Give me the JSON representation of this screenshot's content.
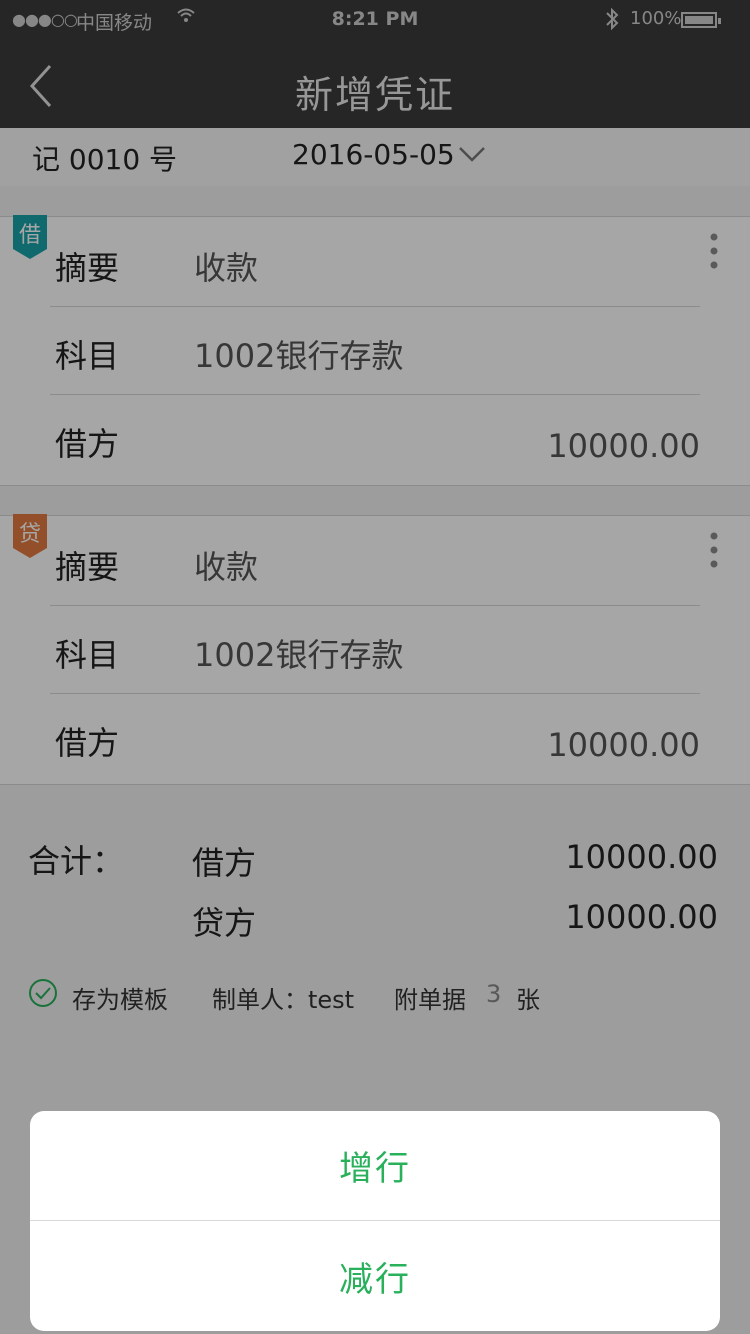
{
  "status_bar": {
    "signal": "●●●○○",
    "carrier": "中国移动",
    "time": "8:21 PM",
    "battery_pct": "100%"
  },
  "nav": {
    "title": "新增凭证"
  },
  "voucher": {
    "number": "记 0010 号",
    "date": "2016-05-05"
  },
  "entries": [
    {
      "tag": "借",
      "tag_color": "#1aa3a8",
      "summary_label": "摘要",
      "summary_value": "收款",
      "subject_label": "科目",
      "subject_value": "1002银行存款",
      "amount_label": "借方",
      "amount_value": "10000.00"
    },
    {
      "tag": "贷",
      "tag_color": "#e07a3f",
      "summary_label": "摘要",
      "summary_value": "收款",
      "subject_label": "科目",
      "subject_value": "1002银行存款",
      "amount_label": "借方",
      "amount_value": "10000.00"
    }
  ],
  "totals": {
    "label": "合计：",
    "debit_label": "借方",
    "debit_amount": "10000.00",
    "credit_label": "贷方",
    "credit_amount": "10000.00"
  },
  "footer": {
    "save_template": "存为模板",
    "maker": "制单人：test",
    "attach_label": "附单据",
    "attach_count": "3",
    "attach_unit": "张"
  },
  "action_sheet": {
    "add_row": "增行",
    "remove_row": "减行"
  },
  "colors": {
    "accent_green": "#28b05b"
  }
}
